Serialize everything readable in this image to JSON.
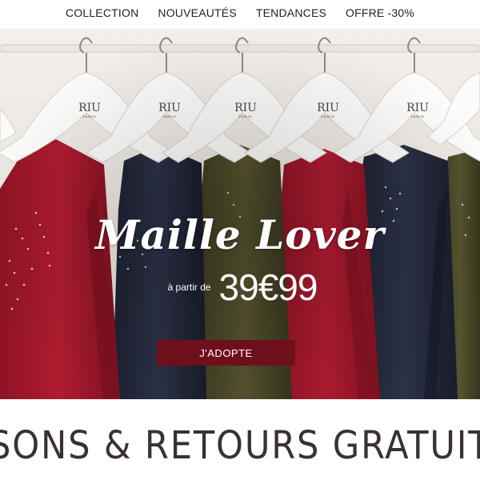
{
  "nav": {
    "items": [
      {
        "label": "COLLECTION"
      },
      {
        "label": "NOUVEAUTÉS"
      },
      {
        "label": "TENDANCES"
      },
      {
        "label": "OFFRE -30%"
      }
    ]
  },
  "hero": {
    "brand_label": "RIU",
    "brand_sub": "PARIS",
    "title": "Maille Lover",
    "price_prefix": "à partir de",
    "price": "39€99",
    "cta_label": "J'ADOPTE"
  },
  "banner": {
    "text": "SONS & RETOURS GRATUITS EN BO"
  },
  "colors": {
    "cta": "#6e0f1c",
    "garment_red": "#a3172a",
    "garment_navy": "#252b3e",
    "garment_khaki": "#4d4a2c",
    "text_dark": "#3a3230"
  }
}
